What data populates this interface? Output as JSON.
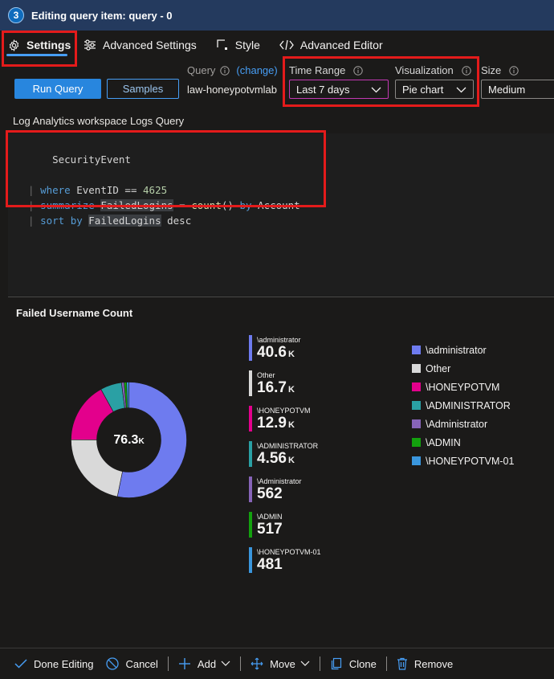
{
  "titlebar": {
    "step": "3",
    "title": "Editing query item: query - 0"
  },
  "tabs": [
    {
      "label": "Settings",
      "icon": "gear-icon",
      "active": true
    },
    {
      "label": "Advanced Settings",
      "icon": "sliders-icon"
    },
    {
      "label": "Style",
      "icon": "square-corner-icon"
    },
    {
      "label": "Advanced Editor",
      "icon": "code-icon"
    }
  ],
  "toolbar": {
    "run_label": "Run Query",
    "samples_label": "Samples",
    "query_label": "Query",
    "change_label": "(change)",
    "query_value": "law-honeypotvmlab",
    "time_range_label": "Time Range",
    "time_range_value": "Last 7 days",
    "visualization_label": "Visualization",
    "visualization_value": "Pie chart",
    "size_label": "Size",
    "size_value": "Medium"
  },
  "editor": {
    "label": "Log Analytics workspace Logs Query",
    "lines": [
      "SecurityEvent",
      "| where EventID == 4625",
      "| summarize FailedLogins = count() by Account",
      "| sort by FailedLogins desc"
    ]
  },
  "chart_data": {
    "type": "pie",
    "title": "Failed Username Count",
    "center_label": "76.3",
    "center_unit": "K",
    "slices": [
      {
        "name": "\\administrator",
        "display": "40.6",
        "unit": "K",
        "value": 40600,
        "color": "#6e7bef"
      },
      {
        "name": "Other",
        "display": "16.7",
        "unit": "K",
        "value": 16700,
        "color": "#d9d9d9"
      },
      {
        "name": "\\HONEYPOTVM",
        "display": "12.9",
        "unit": "K",
        "value": 12900,
        "color": "#e3008c"
      },
      {
        "name": "\\ADMINISTRATOR",
        "display": "4.56",
        "unit": "K",
        "value": 4560,
        "color": "#2aa0a4"
      },
      {
        "name": "\\Administrator",
        "display": "562",
        "unit": "",
        "value": 562,
        "color": "#8764b8"
      },
      {
        "name": "\\ADMIN",
        "display": "517",
        "unit": "",
        "value": 517,
        "color": "#13a10e"
      },
      {
        "name": "\\HONEYPOTVM-01",
        "display": "481",
        "unit": "",
        "value": 481,
        "color": "#3a96dd"
      }
    ]
  },
  "footer": {
    "done_label": "Done Editing",
    "cancel_label": "Cancel",
    "add_label": "Add",
    "move_label": "Move",
    "clone_label": "Clone",
    "remove_label": "Remove"
  }
}
